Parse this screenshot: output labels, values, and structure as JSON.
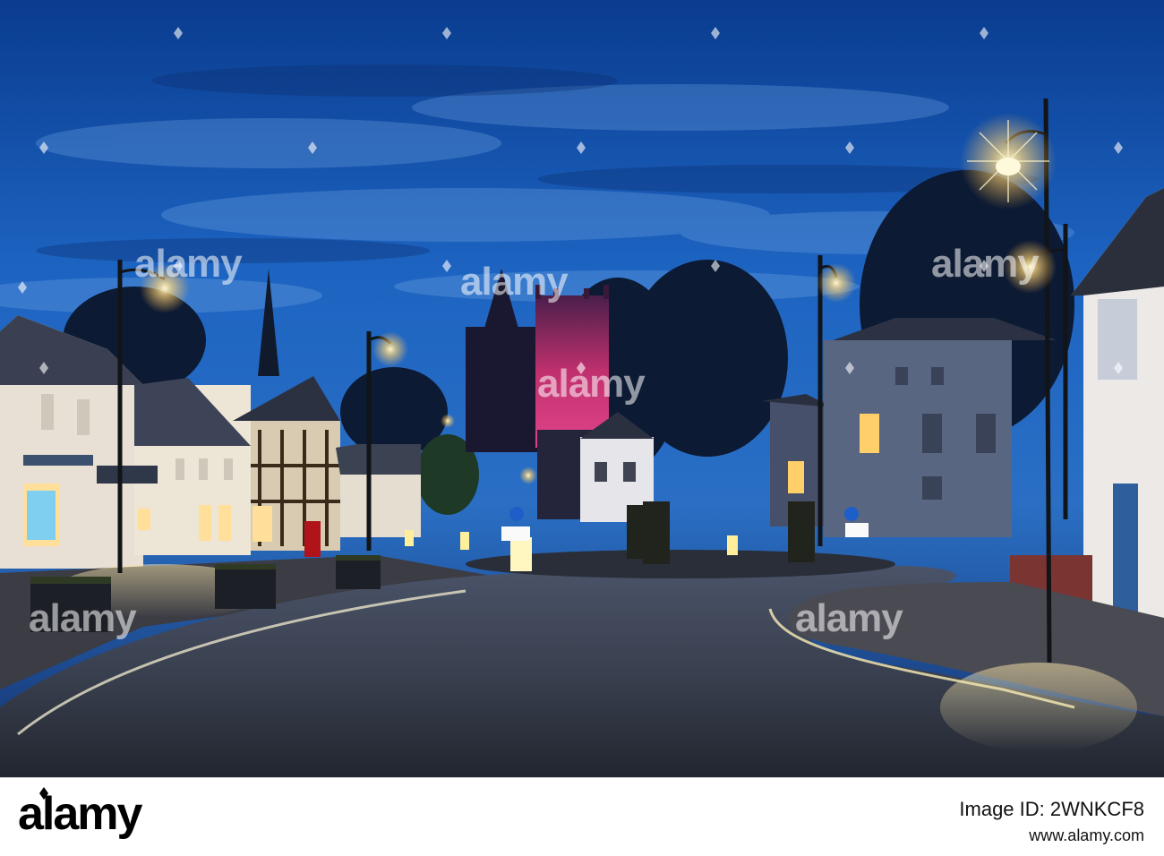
{
  "watermark": {
    "text": "alamy"
  },
  "footer": {
    "brand": "alamy",
    "image_id": "Image ID: 2WNKCF8",
    "site": "www.alamy.com"
  }
}
